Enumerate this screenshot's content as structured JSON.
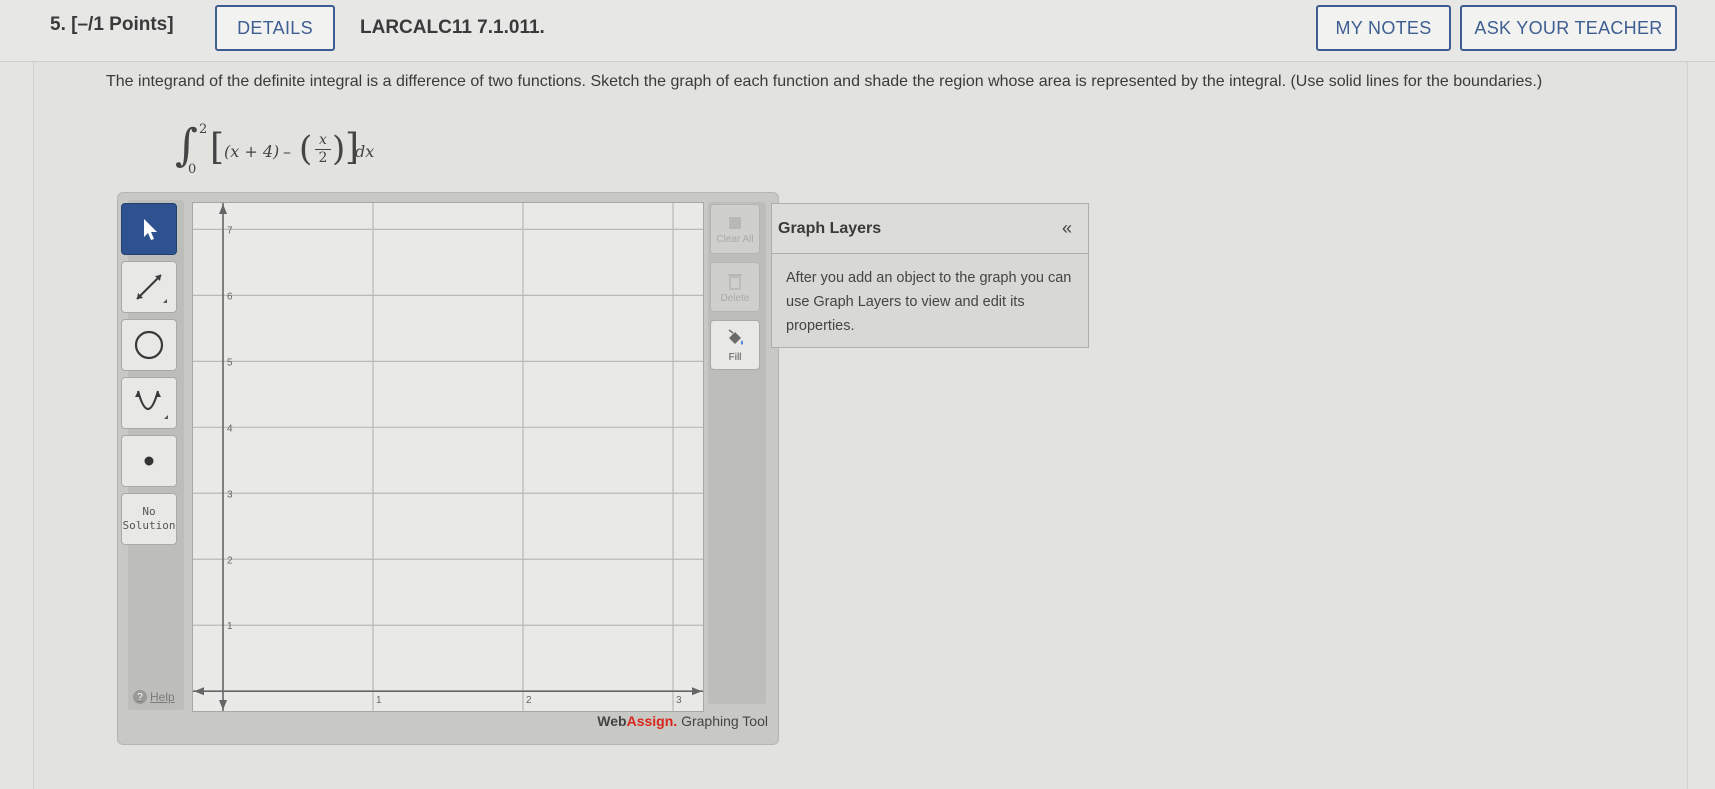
{
  "header": {
    "question_number": "5.",
    "points": "[–/1 Points]",
    "details_label": "DETAILS",
    "assignment_code": "LARCALC11 7.1.011.",
    "my_notes_label": "MY NOTES",
    "ask_teacher_label": "ASK YOUR TEACHER"
  },
  "question": {
    "text": "The integrand of the definite integral is a difference of two functions. Sketch the graph of each function and shade the region whose area is represented by the integral. (Use solid lines for the boundaries.)",
    "integral": {
      "lower": "0",
      "upper": "2",
      "term1": "(x + 4)",
      "minus": "–",
      "frac_num": "x",
      "frac_den": "2",
      "differential": "dx"
    }
  },
  "graph_tool": {
    "left_tools": [
      {
        "name": "select-tool",
        "icon": "pointer-icon"
      },
      {
        "name": "line-tool",
        "icon": "line-segment-icon"
      },
      {
        "name": "circle-tool",
        "icon": "circle-icon"
      },
      {
        "name": "parabola-tool",
        "icon": "parabola-icon"
      },
      {
        "name": "point-tool",
        "icon": "point-icon"
      }
    ],
    "no_solution_line1": "No",
    "no_solution_line2": "Solution",
    "help_label": "Help",
    "help_icon": "?",
    "x_ticks": [
      "1",
      "2",
      "3"
    ],
    "y_ticks": [
      "1",
      "2",
      "3",
      "4",
      "5",
      "6",
      "7"
    ],
    "x_range": [
      -0.2,
      3.2
    ],
    "y_range": [
      -0.3,
      7.4
    ],
    "right_tools": [
      {
        "label": "Clear All",
        "enabled": false,
        "icon": "clear-icon"
      },
      {
        "label": "Delete",
        "enabled": false,
        "icon": "trash-icon"
      },
      {
        "label": "Fill",
        "enabled": true,
        "icon": "fill-bucket-icon"
      }
    ],
    "brand_web": "Web",
    "brand_assign": "Assign.",
    "brand_suffix": " Graphing Tool"
  },
  "layers": {
    "title": "Graph Layers",
    "collapse_glyph": "«",
    "body": "After you add an object to the graph you can use Graph Layers to view and edit its properties."
  },
  "colors": {
    "accent_blue": "#3e5e92",
    "brand_red": "#d9261c",
    "active_tool": "#2e5290"
  }
}
